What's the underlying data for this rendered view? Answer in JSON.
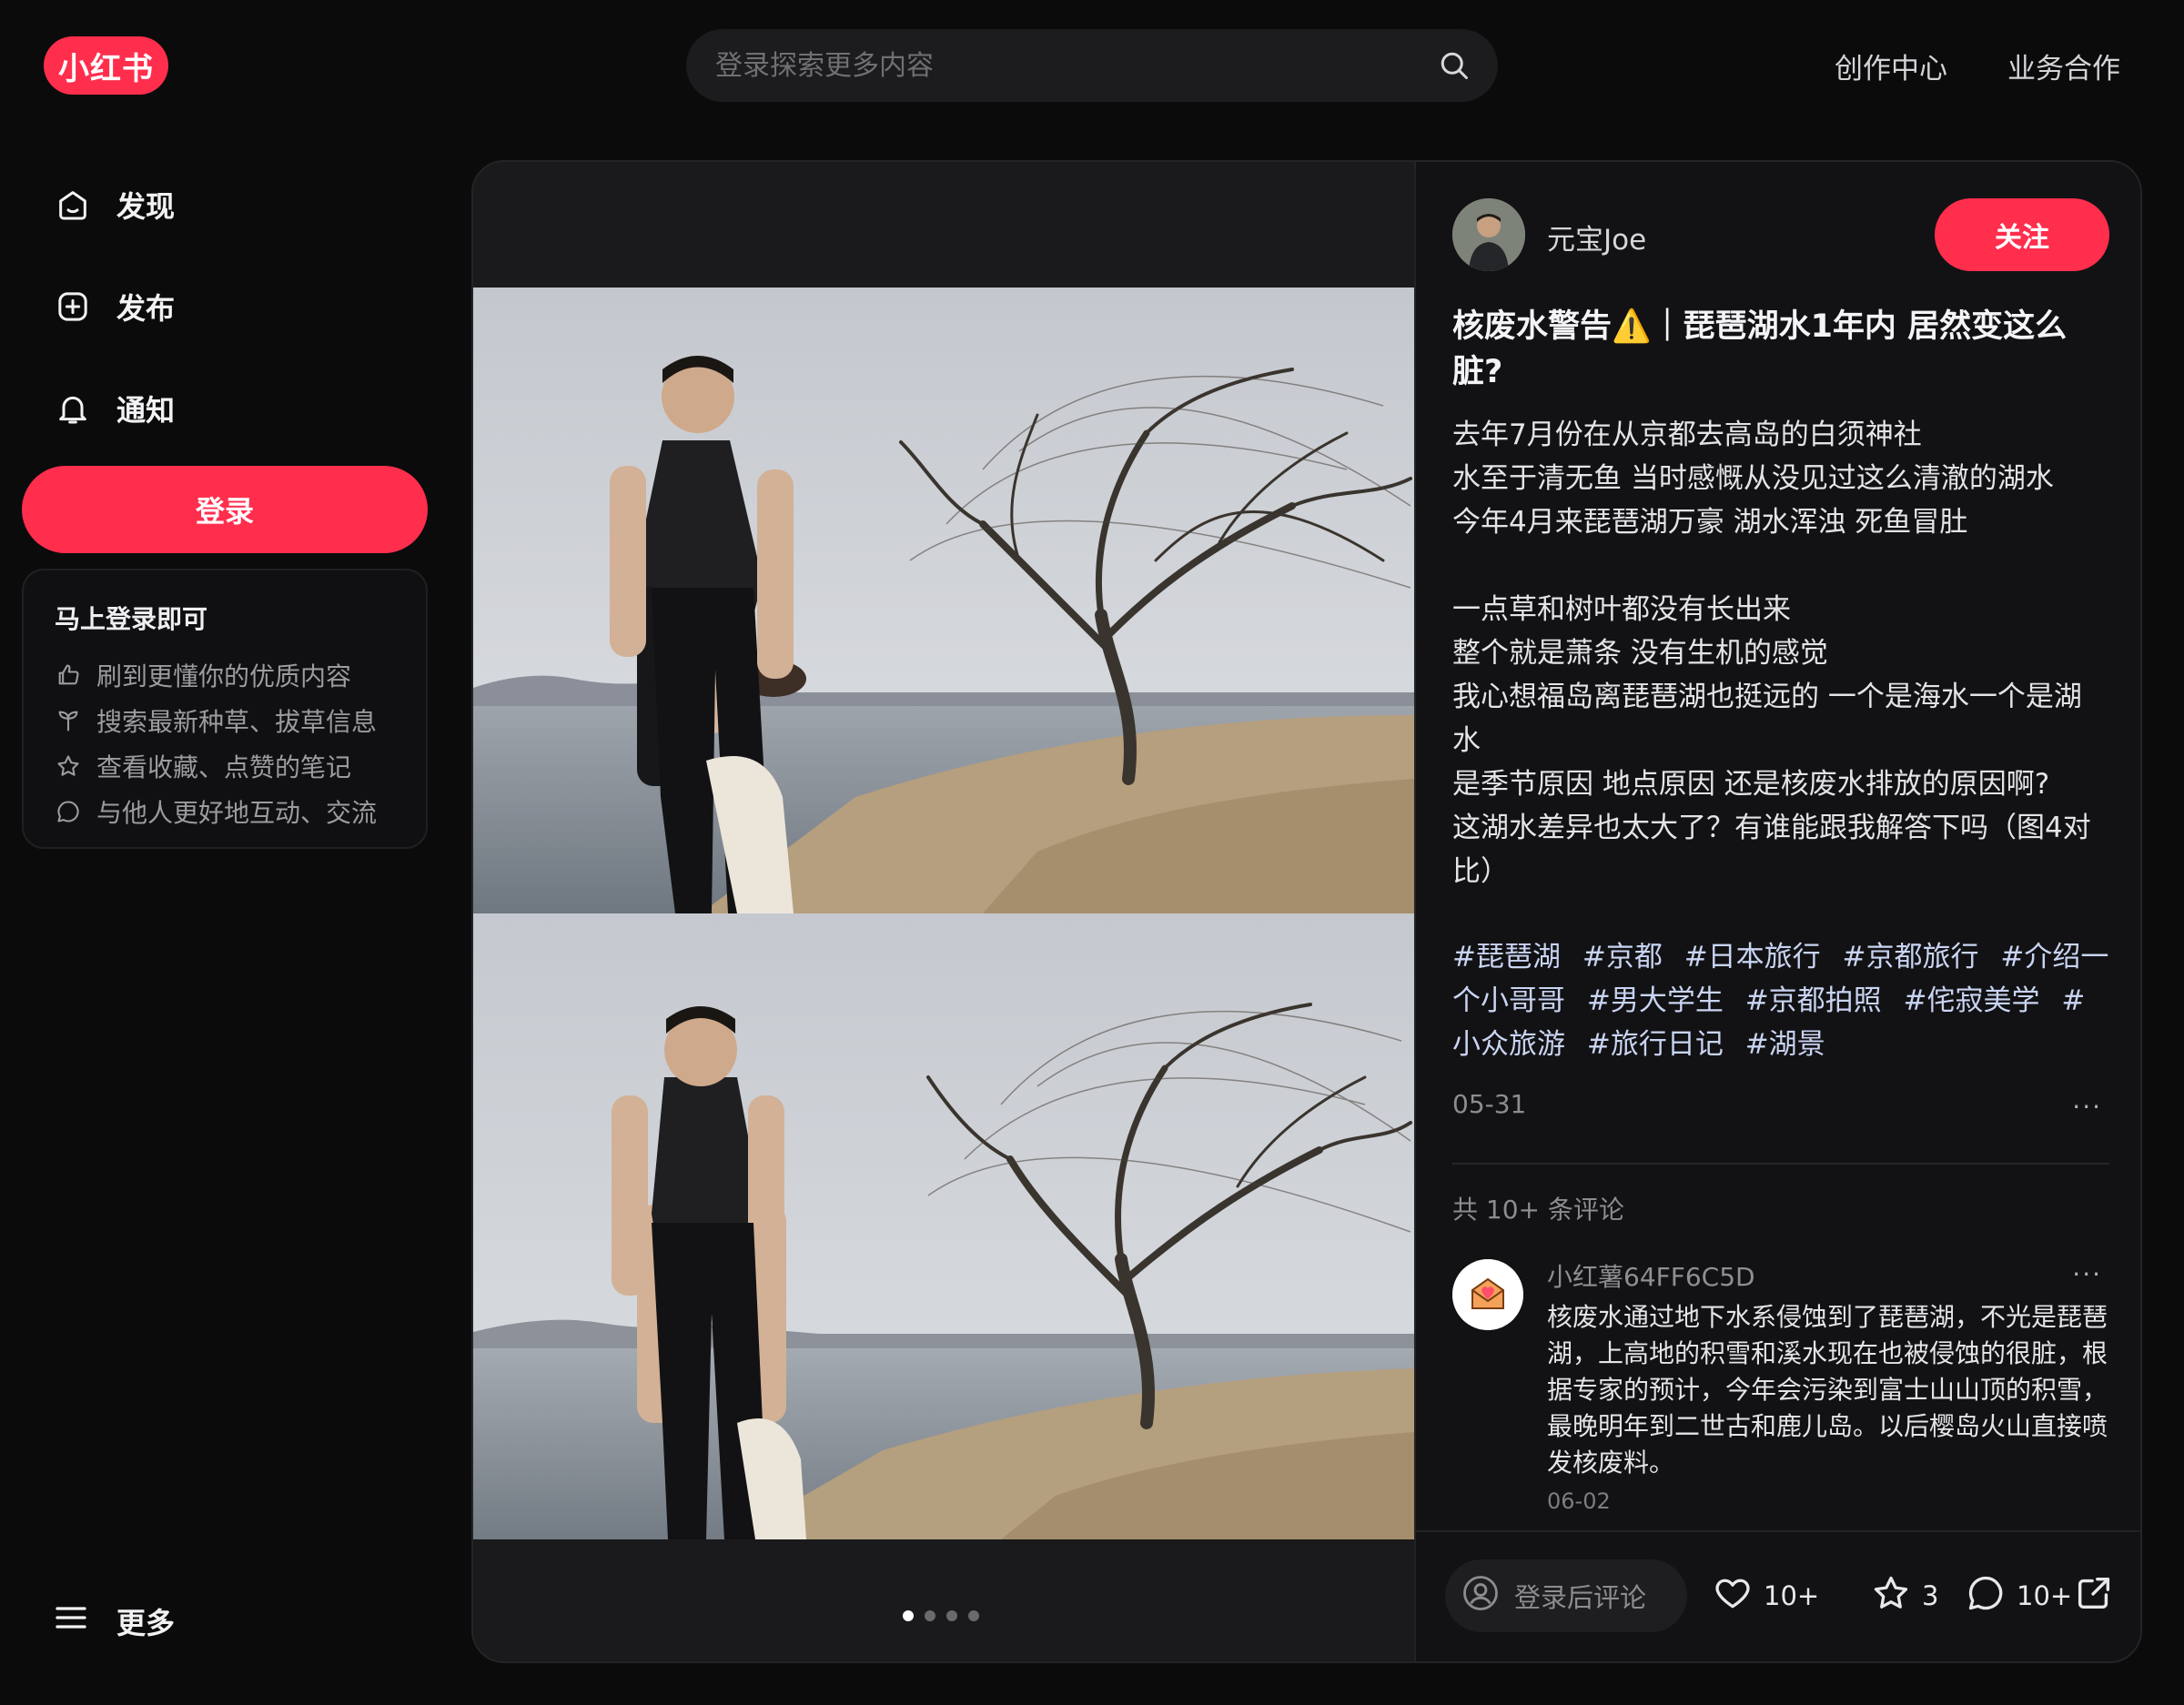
{
  "header": {
    "logo_text": "小红书",
    "search_placeholder": "登录探索更多内容",
    "links": [
      "创作中心",
      "业务合作"
    ]
  },
  "sidebar": {
    "nav": [
      {
        "label": "发现",
        "icon": "home-icon"
      },
      {
        "label": "发布",
        "icon": "plus-square-icon"
      },
      {
        "label": "通知",
        "icon": "bell-icon"
      }
    ],
    "login_button": "登录",
    "login_card": {
      "title": "马上登录即可",
      "items": [
        {
          "text": "刷到更懂你的优质内容",
          "icon": "thumbs-up-icon"
        },
        {
          "text": "搜索最新种草、拔草信息",
          "icon": "sprout-icon"
        },
        {
          "text": "查看收藏、点赞的笔记",
          "icon": "star-icon"
        },
        {
          "text": "与他人更好地互动、交流",
          "icon": "chat-icon"
        }
      ]
    },
    "more_label": "更多"
  },
  "note": {
    "author": "元宝Joe",
    "follow_label": "关注",
    "title": "核废水警告⚠️｜琵琶湖水1年内 居然变这么脏?",
    "description": [
      "去年7月份在从京都去高岛的白须神社",
      "水至于清无鱼 当时感慨从没见过这么清澈的湖水",
      "今年4月来琵琶湖万豪 湖水浑浊 死鱼冒肚",
      "",
      "一点草和树叶都没有长出来",
      "整个就是萧条 没有生机的感觉",
      "我心想福岛离琵琶湖也挺远的 一个是海水一个是湖水",
      "是季节原因 地点原因 还是核废水排放的原因啊?",
      "这湖水差异也太大了？有谁能跟我解答下吗（图4对比）"
    ],
    "tags": [
      "#琵琶湖",
      "#京都",
      "#日本旅行",
      "#京都旅行",
      "#介绍一个小哥哥",
      "#男大学生",
      "#京都拍照",
      "#侘寂美学",
      "#小众旅游",
      "#旅行日记",
      "#湖景"
    ],
    "date": "05-31",
    "more": "···",
    "image_count": 4,
    "current_image_index": 1,
    "comment_count_label": "共 10+ 条评论",
    "comments": [
      {
        "user": "小红薯64FF6C5D",
        "text": "核废水通过地下水系侵蚀到了琵琶湖，不光是琵琶湖，上高地的积雪和溪水现在也被侵蚀的很脏，根据专家的预计，今年会污染到富士山山顶的积雪，最晚明年到二世古和鹿儿岛。以后樱岛火山直接喷发核废料。",
        "date": "06-02",
        "more": "···"
      }
    ],
    "bottom": {
      "comment_placeholder": "登录后评论",
      "likes": "10+",
      "collects": "3",
      "comments": "10+"
    }
  },
  "colors": {
    "accent": "#ff2e4d",
    "background": "#0b0b0c",
    "panel": "#121214"
  }
}
